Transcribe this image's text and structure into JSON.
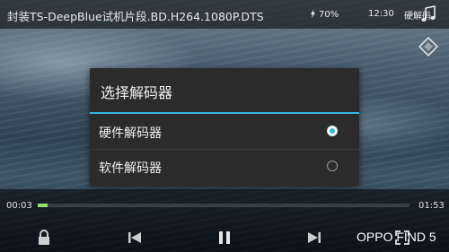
{
  "top_bar": {
    "title": "封装TS-DeepBlue试机片段.BD.H264.1080P.DTS",
    "battery": "70%",
    "clock": "12:30",
    "decoder_button": "硬解码"
  },
  "dialog": {
    "title": "选择解码器",
    "options": [
      {
        "label": "硬件解码器",
        "selected": true
      },
      {
        "label": "软件解码器",
        "selected": false
      }
    ],
    "accent_color": "#33b5e5"
  },
  "controls": {
    "elapsed": "00:03",
    "total": "01:53",
    "progress_fraction": 0.027
  },
  "watermark": "OPPO FIND 5",
  "icons": [
    "battery-icon",
    "music-icon",
    "rotate-icon",
    "lock-icon",
    "previous-icon",
    "pause-icon",
    "next-icon",
    "fullscreen-icon"
  ]
}
